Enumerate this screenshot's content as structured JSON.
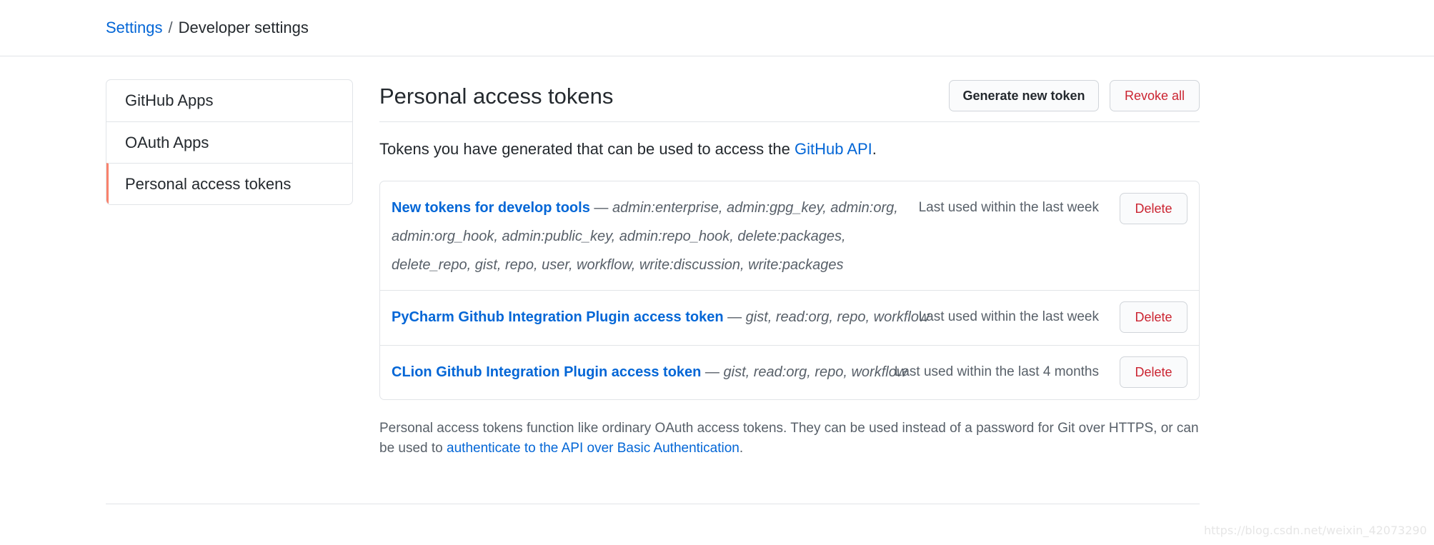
{
  "breadcrumb": {
    "parent": "Settings",
    "separator": "/",
    "current": "Developer settings"
  },
  "sidebar": {
    "items": [
      {
        "label": "GitHub Apps"
      },
      {
        "label": "OAuth Apps"
      },
      {
        "label": "Personal access tokens",
        "selected": true
      }
    ]
  },
  "main": {
    "title": "Personal access tokens",
    "generate_label": "Generate new token",
    "revoke_label": "Revoke all",
    "intro_text": "Tokens you have generated that can be used to access the ",
    "intro_link": "GitHub API",
    "intro_end": "."
  },
  "tokens": [
    {
      "name": "New tokens for develop tools",
      "dash": " — ",
      "scopes": "admin:enterprise, admin:gpg_key, admin:org, admin:org_hook, admin:public_key, admin:repo_hook, delete:packages, delete_repo, gist, repo, user, workflow, write:discussion, write:packages",
      "last_used": "Last used within the last week",
      "delete_label": "Delete"
    },
    {
      "name": "PyCharm Github Integration Plugin access token",
      "dash": " — ",
      "scopes": "gist, read:org, repo, workflow",
      "last_used": "Last used within the last week",
      "delete_label": "Delete"
    },
    {
      "name": "CLion Github Integration Plugin access token",
      "dash": " — ",
      "scopes": "gist, read:org, repo, workflow",
      "last_used": "Last used within the last 4 months",
      "delete_label": "Delete"
    }
  ],
  "footnote": {
    "text": "Personal access tokens function like ordinary OAuth access tokens. They can be used instead of a password for Git over HTTPS, or can be used to ",
    "link": "authenticate to the API over Basic Authentication",
    "end": "."
  },
  "watermark": "https://blog.csdn.net/weixin_42073290",
  "colors": {
    "link": "#0366d6",
    "danger": "#cb2431",
    "selected_accent": "#f9826c",
    "border": "#e1e4e8"
  }
}
